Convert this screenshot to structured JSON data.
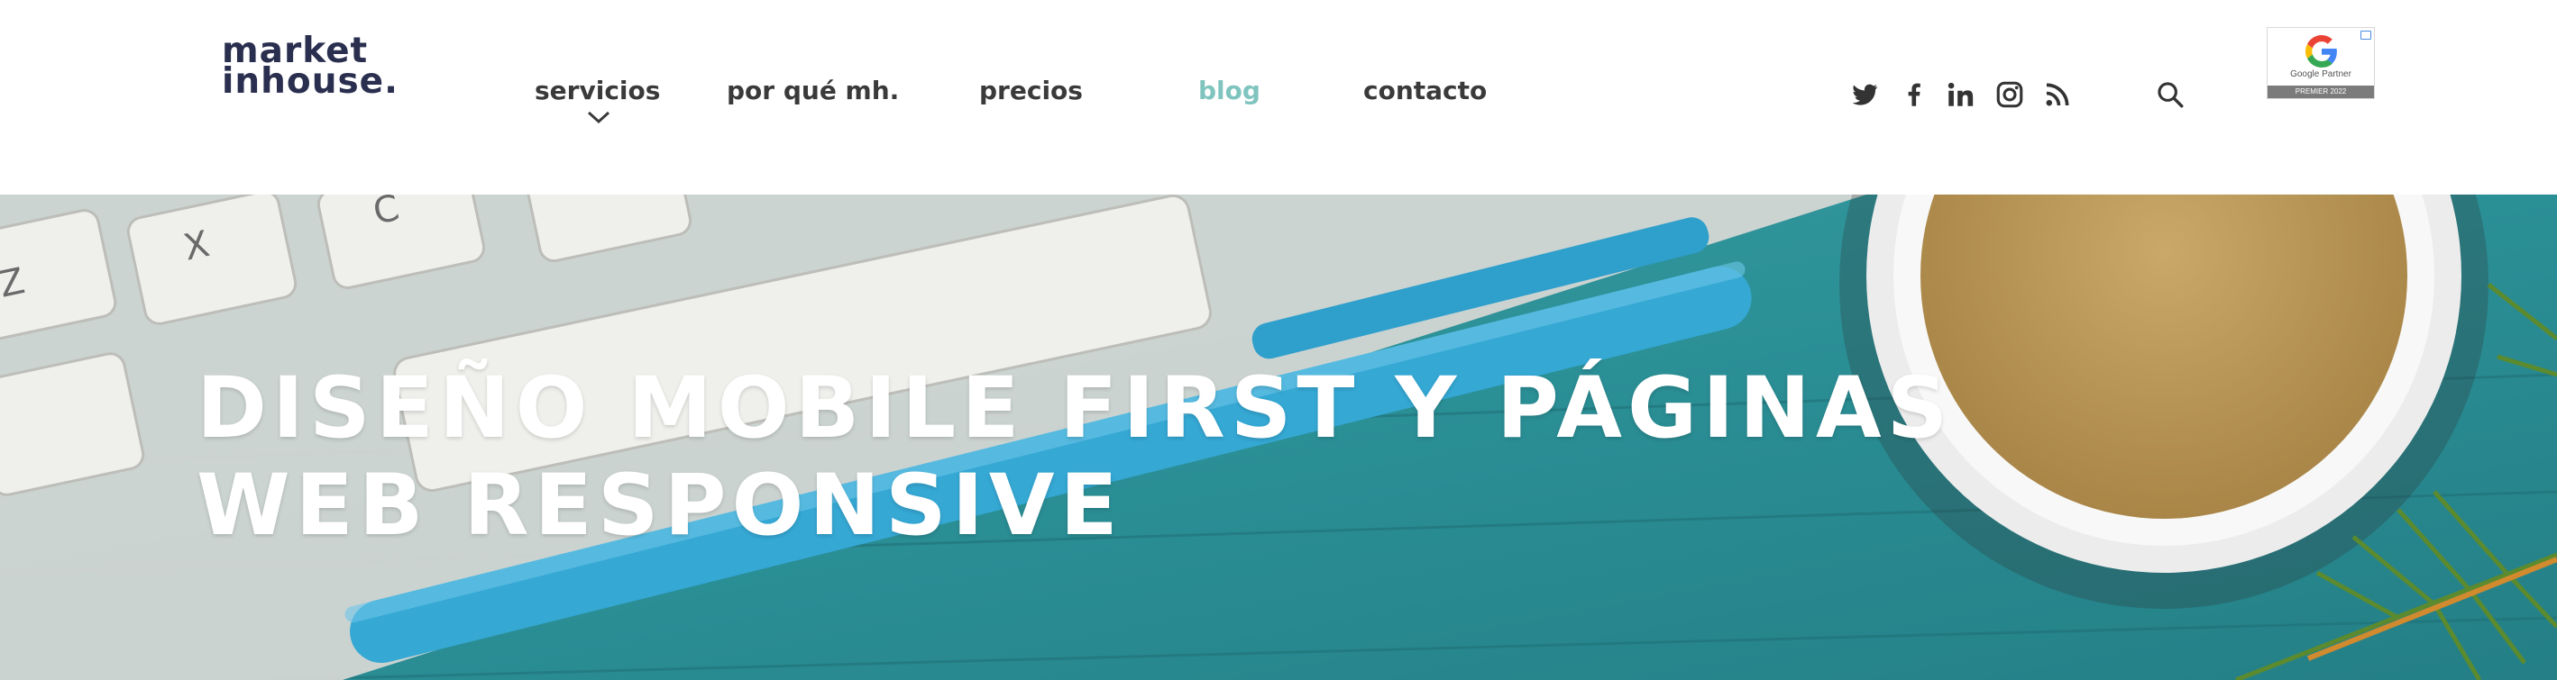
{
  "brand": {
    "line1": "market",
    "line2": "inhouse."
  },
  "nav": {
    "items": [
      {
        "label": "servicios"
      },
      {
        "label": "por qué mh."
      },
      {
        "label": "precios"
      },
      {
        "label": "blog"
      },
      {
        "label": "contacto"
      }
    ],
    "active": "blog"
  },
  "social": [
    "twitter-icon",
    "facebook-icon",
    "linkedin-icon",
    "instagram-icon",
    "rss-icon"
  ],
  "badge": {
    "label": "Google Partner",
    "footer": "PREMIER 2022"
  },
  "hero": {
    "title_line1": "DISEÑO MOBILE FIRST Y PÁGINAS",
    "title_line2": "WEB RESPONSIVE"
  },
  "colors": {
    "brand": "#2a2f4f",
    "accent": "#7fc4bf",
    "nav_text": "#3a3a3a",
    "hero_teal": "#2b8f96"
  }
}
